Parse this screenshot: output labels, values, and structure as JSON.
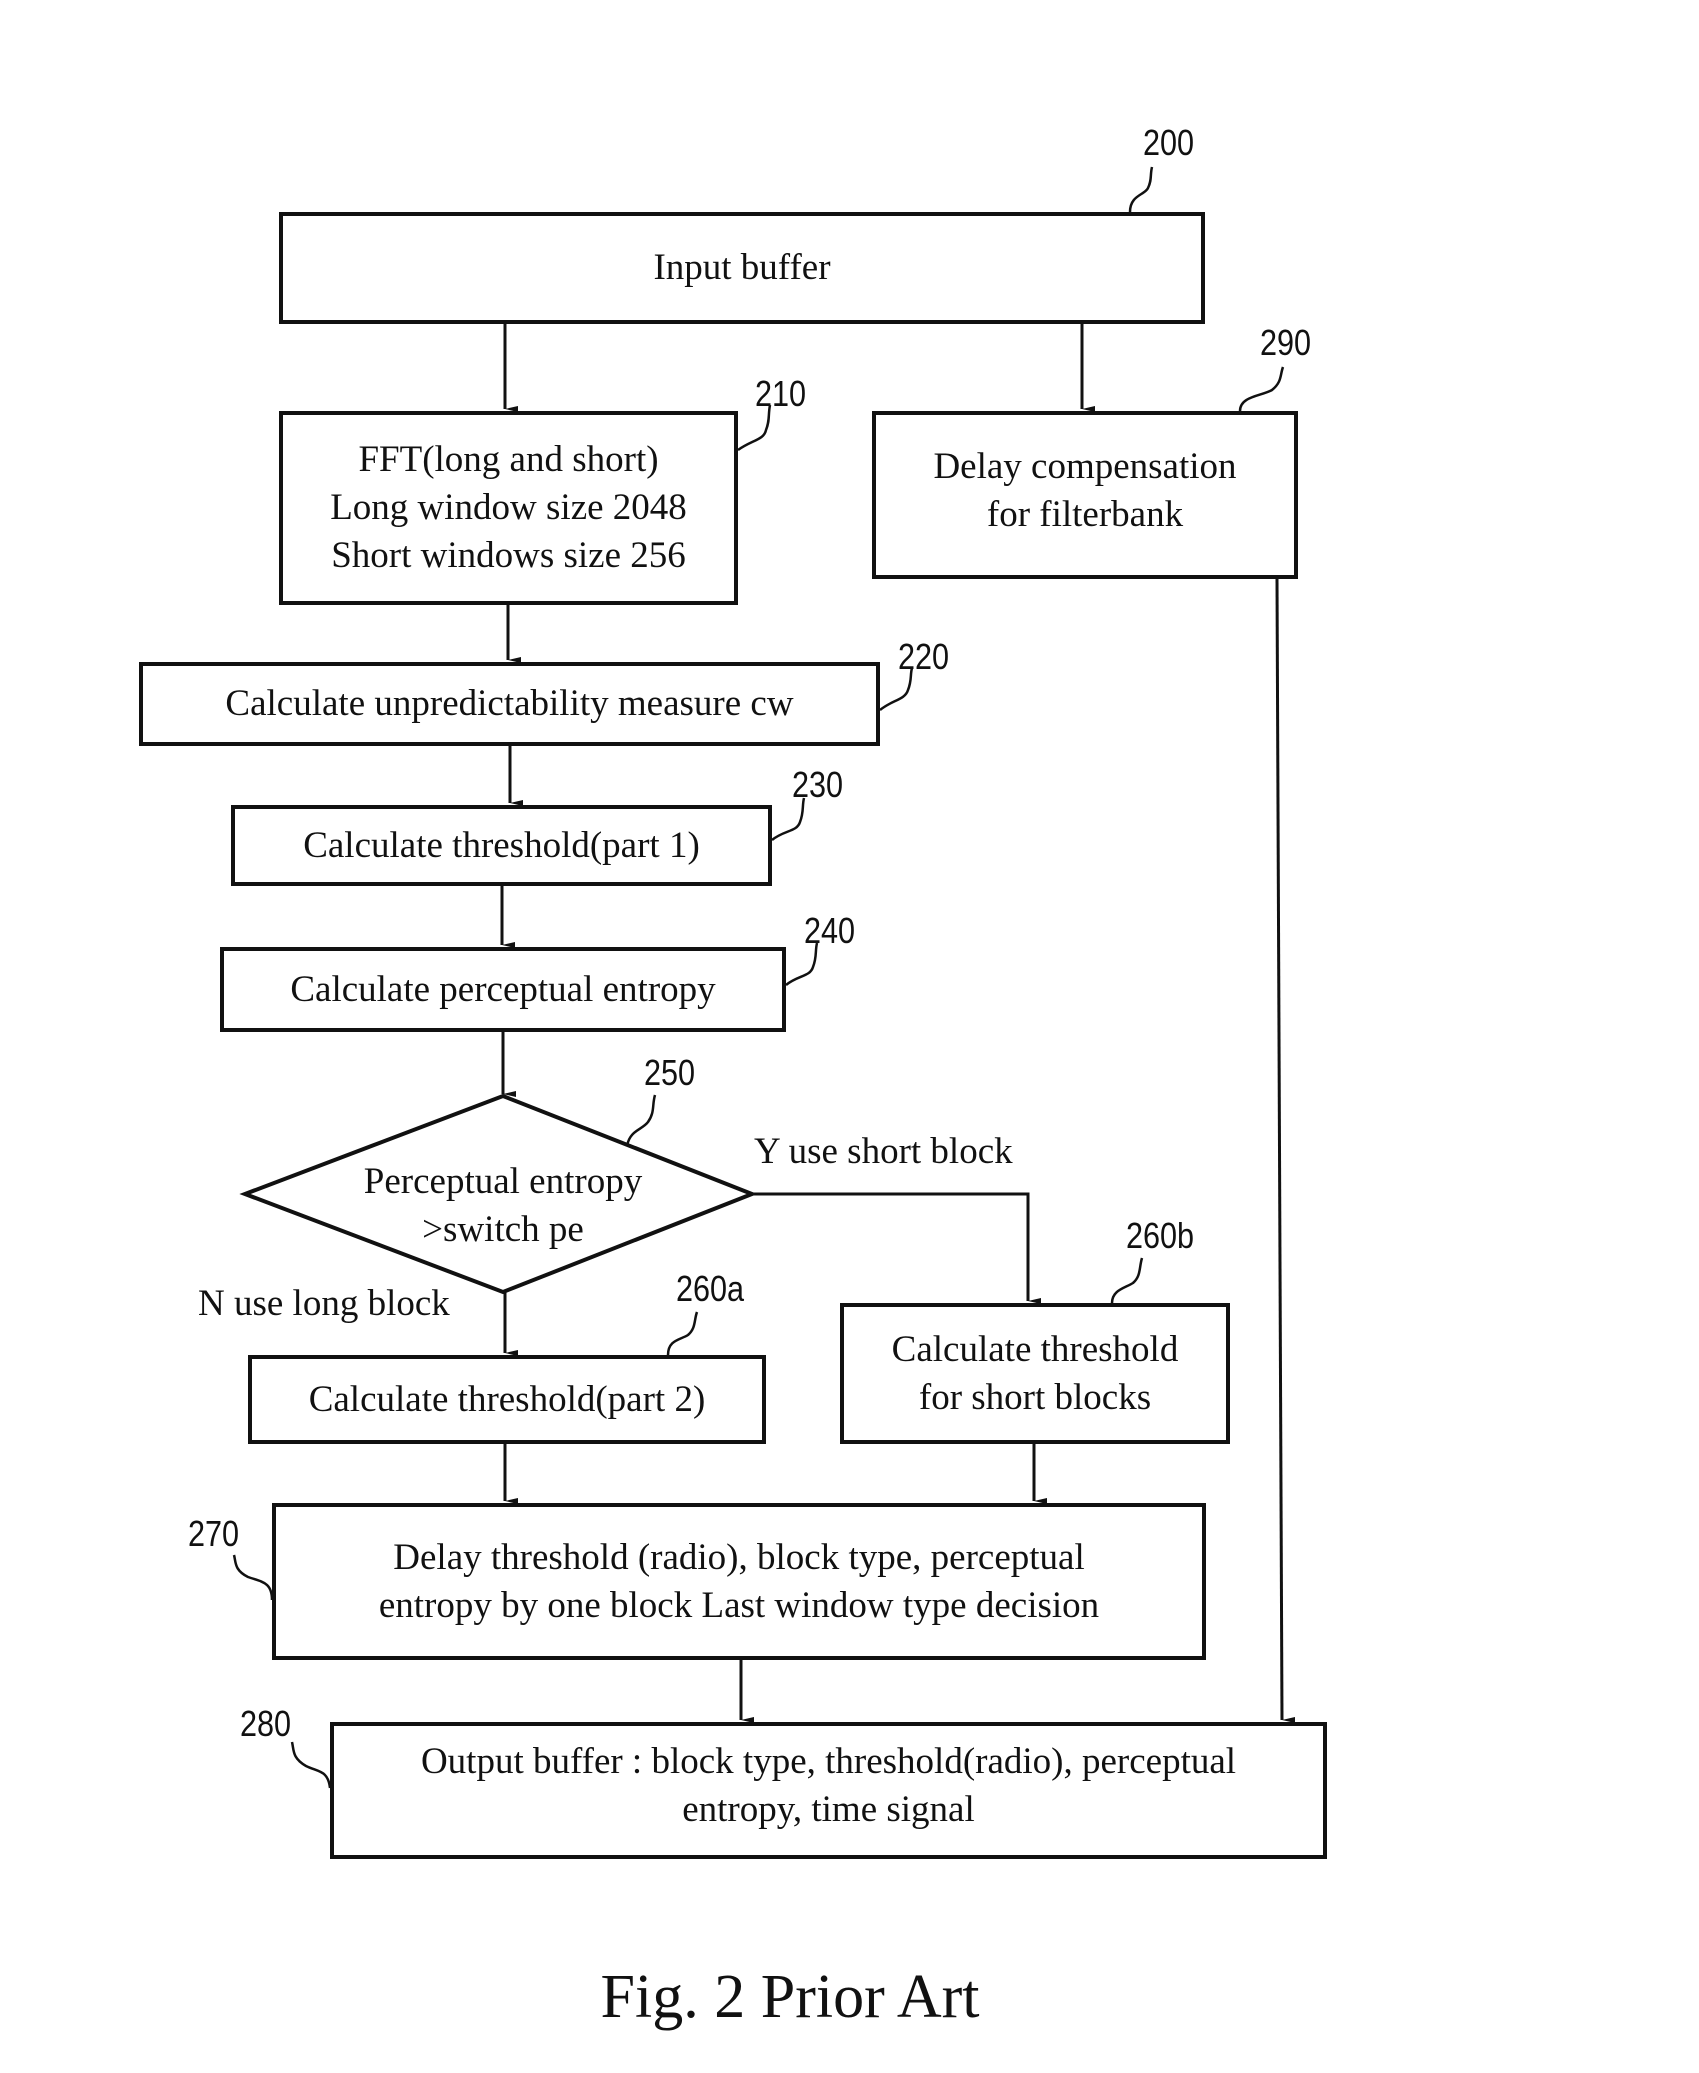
{
  "figure": {
    "caption": "Fig. 2 Prior Art"
  },
  "nodes": {
    "n200": {
      "ref": "200",
      "lines": [
        "Input buffer"
      ]
    },
    "n210": {
      "ref": "210",
      "lines": [
        "FFT(long and short)",
        "Long window size 2048",
        "Short windows size 256"
      ]
    },
    "n290": {
      "ref": "290",
      "lines": [
        "Delay compensation",
        "for filterbank"
      ]
    },
    "n220": {
      "ref": "220",
      "lines": [
        "Calculate unpredictability measure cw"
      ]
    },
    "n230": {
      "ref": "230",
      "lines": [
        "Calculate threshold(part 1)"
      ]
    },
    "n240": {
      "ref": "240",
      "lines": [
        "Calculate perceptual entropy"
      ]
    },
    "n250": {
      "ref": "250",
      "lines": [
        "Perceptual entropy",
        ">switch pe"
      ]
    },
    "n260a": {
      "ref": "260a",
      "lines": [
        "Calculate threshold(part 2)"
      ]
    },
    "n260b": {
      "ref": "260b",
      "lines": [
        "Calculate threshold",
        "for short blocks"
      ]
    },
    "n270": {
      "ref": "270",
      "lines": [
        "Delay threshold (radio), block type, perceptual",
        "entropy by one block Last window type decision"
      ]
    },
    "n280": {
      "ref": "280",
      "lines": [
        "Output buffer : block type, threshold(radio), perceptual",
        "entropy, time signal"
      ]
    }
  },
  "edges": {
    "yes_label": "Y use short block",
    "no_label": "N use long block"
  }
}
